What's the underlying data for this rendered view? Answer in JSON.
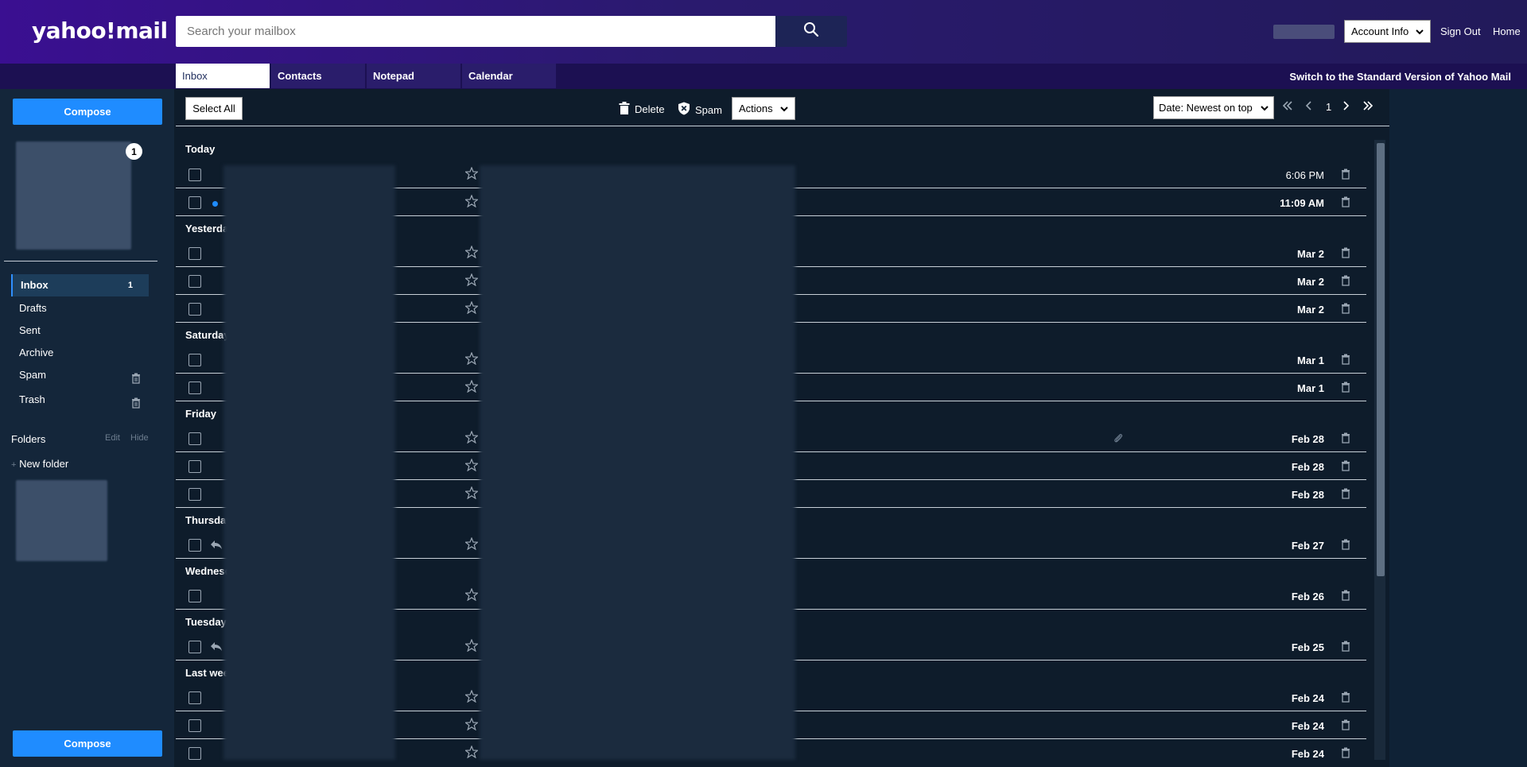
{
  "header": {
    "logo": "yahoo!mail",
    "search_placeholder": "Search your mailbox",
    "account_select": "Account Info",
    "sign_out": "Sign Out",
    "home": "Home"
  },
  "tabs": [
    {
      "label": "Inbox"
    },
    {
      "label": "Contacts"
    },
    {
      "label": "Notepad"
    },
    {
      "label": "Calendar"
    }
  ],
  "switch_link": "Switch to the Standard Version of Yahoo Mail",
  "sidebar": {
    "compose_label": "Compose",
    "profile_badge": "1",
    "items": [
      {
        "label": "Inbox",
        "count": "1"
      },
      {
        "label": "Drafts"
      },
      {
        "label": "Sent"
      },
      {
        "label": "Archive"
      },
      {
        "label": "Spam"
      },
      {
        "label": "Trash"
      }
    ],
    "folders_label": "Folders",
    "folders_edit": "Edit",
    "folders_hide": "Hide",
    "new_folder": "New folder",
    "compose_bottom_label": "Compose"
  },
  "toolbar": {
    "select_all": "Select All",
    "delete": "Delete",
    "spam": "Spam",
    "actions": "Actions",
    "sort": "Date: Newest on top",
    "page": "1"
  },
  "groups": [
    {
      "label": "Today"
    },
    {
      "label": "Yesterday"
    },
    {
      "label": "Saturday"
    },
    {
      "label": "Friday"
    },
    {
      "label": "Thursday"
    },
    {
      "label": "Wednesday"
    },
    {
      "label": "Tuesday"
    },
    {
      "label": "Last week"
    }
  ],
  "messages": [
    {
      "date": "6:06 PM"
    },
    {
      "date": "11:09 AM"
    },
    {
      "date": "Mar 2"
    },
    {
      "date": "Mar 2"
    },
    {
      "date": "Mar 2"
    },
    {
      "date": "Mar 1"
    },
    {
      "date": "Mar 1"
    },
    {
      "date": "Feb 28"
    },
    {
      "date": "Feb 28"
    },
    {
      "date": "Feb 28"
    },
    {
      "date": "Feb 27"
    },
    {
      "date": "Feb 26"
    },
    {
      "date": "Feb 25"
    },
    {
      "date": "Feb 24"
    },
    {
      "date": "Feb 24"
    },
    {
      "date": "Feb 24"
    }
  ],
  "colors": {
    "accent": "#1f8cff",
    "header": "#3a0f91",
    "background": "#0e1c2b"
  }
}
